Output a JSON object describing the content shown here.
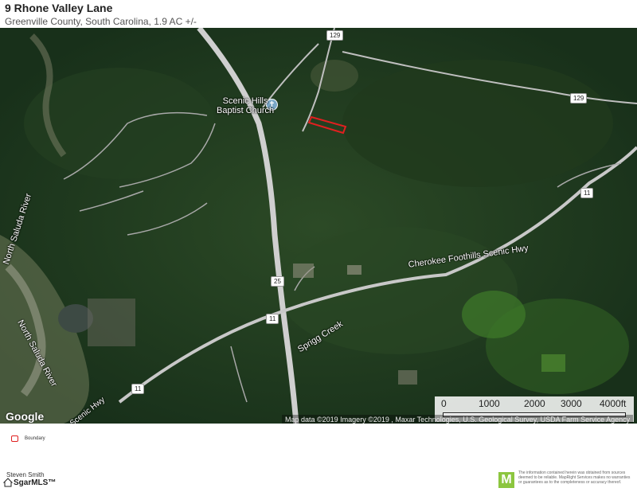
{
  "header": {
    "title": "9 Rhone Valley Lane",
    "subtitle": "Greenville County, South Carolina, 1.9 AC +/-"
  },
  "map": {
    "labels": {
      "church_line1": "Scenic Hills",
      "church_line2": "Baptist Church",
      "cherokee_hwy": "Cherokee Foothills Scenic Hwy",
      "scenic_hwy_partial": "Scenic Hwy",
      "north_saluda_1": "North Saluda River",
      "north_saluda_2": "North Saluda River",
      "sprigg_creek": "Sprigg Creek"
    },
    "shields": {
      "r129_top": "129",
      "r129_right": "129",
      "r11_right": "11",
      "r25": "25",
      "r11_mid": "11",
      "r11_left": "11"
    },
    "scale": {
      "ticks": [
        "0",
        "1000",
        "2000",
        "3000",
        "4000ft"
      ]
    },
    "google_logo": "Google",
    "attribution": "Map data ©2019  Imagery ©2019 , Maxar Technologies, U.S. Geological Survey, USDA Farm Service Agency"
  },
  "legend": {
    "boundary_label": "Boundary"
  },
  "footer": {
    "agent": "Steven  Smith",
    "mls": "SgarMLS™",
    "mapright_letter": "M",
    "disclaimer": "The information contained herein was obtained from sources deemed to be reliable. MapRight Services makes no warranties or guarantees as to the completeness or accuracy thereof."
  },
  "colors": {
    "boundary": "#e02020",
    "forest": "#1f3a1c",
    "road": "#cfcfcf"
  }
}
